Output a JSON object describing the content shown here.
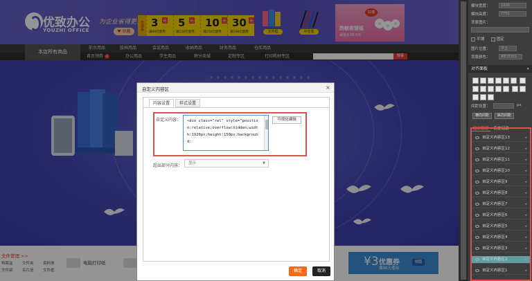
{
  "store": {
    "logo_cn": "优致办公",
    "logo_en": "YOUZHI OFFICE",
    "slogan": "为企业省得更多!",
    "favorite_label": "♥ 收藏",
    "coupon_tag": "优惠券",
    "coupons": [
      {
        "value": "3",
        "unit": "元",
        "cond": "满98元使用"
      },
      {
        "value": "5",
        "unit": "元",
        "cond": "满158元使用"
      },
      {
        "value": "10",
        "unit": "元",
        "cond": "满258元使用"
      },
      {
        "value": "30",
        "unit": "元",
        "cond": "满598元使用"
      }
    ],
    "thumb_tags": [
      "文件框",
      "中性笔"
    ],
    "promo": {
      "badge": "32卷",
      "title": "热敏收银纸",
      "sub": "最低价28.5元"
    },
    "category_all": "本店所有商品",
    "nav_top": [
      "前台用品",
      "胶档用品",
      "会议用品",
      "收纳用品",
      "财务用品",
      "仓库用品"
    ],
    "nav_bottom": [
      "首页领券",
      "办公用品",
      "学生用品",
      "积分商城",
      "定制专区",
      "打印耗材专区"
    ],
    "nav_badge": "6",
    "search_label": "搜索",
    "file_mgmt": "文件管理 >>",
    "file_links": [
      "档案盒",
      "文件夹",
      "资料册",
      "文件袋",
      "名片册",
      "文件框"
    ],
    "bottom_cat": "电脑打印纸",
    "coupon_bar": {
      "value": "¥3",
      "title": "优惠券",
      "sub": "满98元使用",
      "button": "领取"
    }
  },
  "dialog": {
    "title": "自定义内容区",
    "tabs": [
      "内容设置",
      "样式设置"
    ],
    "content_label": "自定义内容：",
    "code": "<div class=\"rel\" style=\"position:relative;overflow:hidden;width:1920px;height:150px;background:",
    "visual_edit": "可视化编辑",
    "overflow_label": "超出部分内容：",
    "overflow_value": "显示",
    "ok": "确定",
    "cancel": "取消"
  },
  "panel": {
    "props": [
      {
        "label": "模块宽度：",
        "value": "1920"
      },
      {
        "label": "模块高度：",
        "value": "7752"
      },
      {
        "label": "背景图片：",
        "value": ""
      }
    ],
    "check1": "平铺",
    "check2": "固定",
    "pos_label": "图片位置：",
    "pos_value": "中上",
    "color_label": "背景颜色：",
    "color_value": "#E1E1E1",
    "align_head": "对齐面板",
    "spacing_label": "间距设置：",
    "spacing_unit": "px",
    "btn_h": "横向间距",
    "btn_v": "纵向间距",
    "list_tabs": [
      "图层管理",
      "历史记录"
    ],
    "layers": [
      "自定义内容区13",
      "自定义内容区12",
      "自定义内容区11",
      "自定义内容区10",
      "自定义内容区9",
      "自定义内容区8",
      "自定义内容区7",
      "自定义内容区6",
      "自定义内容区5",
      "自定义内容区4",
      "自定义内容区3",
      "自定义内容区2",
      "自定义内容区1"
    ]
  }
}
